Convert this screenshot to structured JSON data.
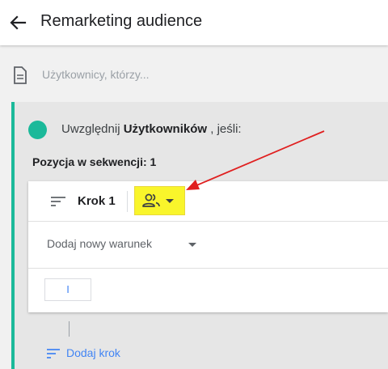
{
  "header": {
    "title": "Remarketing audience",
    "back_icon": "arrow-back-icon"
  },
  "description": {
    "placeholder": "Użytkownicy, którzy..."
  },
  "condition_group": {
    "include_prefix": "Uwzględnij",
    "include_target": "Użytkowników",
    "include_suffix": ", jeśli:",
    "accent_color": "#1bb99a",
    "sequence_label": "Pozycja w sekwencji: 1",
    "step": {
      "label": "Krok 1",
      "scope_icon": "people-icon",
      "add_condition_label": "Dodaj nowy warunek",
      "logic_button_label": "I"
    },
    "add_step_label": "Dodaj krok"
  },
  "annotation": {
    "highlight_color": "#f9f52b",
    "arrow_color": "#e02020"
  }
}
